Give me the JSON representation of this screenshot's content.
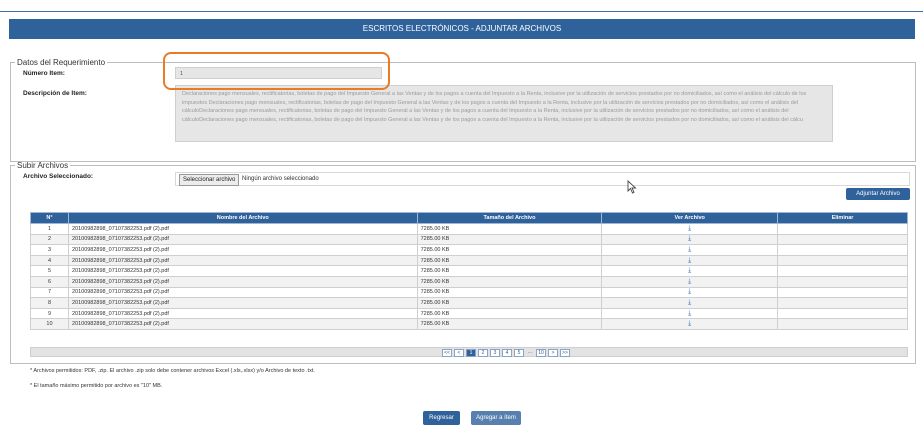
{
  "header": {
    "title": "ESCRITOS ELECTRÓNICOS - ADJUNTAR ARCHIVOS"
  },
  "requerimiento": {
    "legend": "Datos del Requerimiento",
    "numero_label": "Número Item:",
    "numero_value": "1",
    "descripcion_label": "Descripción de Item:",
    "descripcion_value": "Declaraciones pago mensuales, rectificatorias, boletas de pago del Impuesto General a las Ventas y de los pagos a cuenta del Impuesto a la Renta, inclusive por la utilización de servicios prestados por no domiciliados, así como el análisis del cálculo de los impuestos Declaraciones pago mensuales, rectificatorias, boletas de pago del Impuesto General a las Ventas y de los pagos a cuenta del Impuesto a la Renta, inclusive por la utilización de servicios prestados por no domiciliados, así como el análisis del cálculoDeclaraciones pago mensuales, rectificatorias, boletas de pago del Impuesto General a las Ventas y de los pagos a cuenta del Impuesto a la Renta, inclusive por la utilización de servicios prestados por no domiciliados, así como el análisis del cálculoDeclaraciones pago mensuales, rectificatorias, boletas de pago del Impuesto General a las Ventas y de los pagos a cuenta del Impuesto a la Renta, inclusive por la utilización de servicios prestados por no domiciliados, así como el análisis del cálcu"
  },
  "upload": {
    "legend": "Subir Archivos",
    "selected_label": "Archivo Seleccionado:",
    "select_button": "Seleccionar archivo",
    "no_file_text": "Ningún archivo seleccionado",
    "attach_button": "Adjuntar Archivo"
  },
  "table": {
    "headers": [
      "N°",
      "Nombre del Archivo",
      "Tamaño del Archivo",
      "Ver Archivo",
      "Eliminar"
    ],
    "rows": [
      {
        "n": "1",
        "name": "20100982898_07107382253.pdf (2).pdf",
        "size": "7285.00 KB"
      },
      {
        "n": "2",
        "name": "20100982898_07107382253.pdf (2).pdf",
        "size": "7285.00 KB"
      },
      {
        "n": "3",
        "name": "20100982898_07107382253.pdf (2).pdf",
        "size": "7285.00 KB"
      },
      {
        "n": "4",
        "name": "20100982898_07107382253.pdf (2).pdf",
        "size": "7285.00 KB"
      },
      {
        "n": "5",
        "name": "20100982898_07107382253.pdf (2).pdf",
        "size": "7285.00 KB"
      },
      {
        "n": "6",
        "name": "20100982898_07107382253.pdf (2).pdf",
        "size": "7285.00 KB"
      },
      {
        "n": "7",
        "name": "20100982898_07107382253.pdf (2).pdf",
        "size": "7285.00 KB"
      },
      {
        "n": "8",
        "name": "20100982898_07107382253.pdf (2).pdf",
        "size": "7285.00 KB"
      },
      {
        "n": "9",
        "name": "20100982898_07107382253.pdf (2).pdf",
        "size": "7285.00 KB"
      },
      {
        "n": "10",
        "name": "20100982898_07107382253.pdf (2).pdf",
        "size": "7285.00 KB"
      }
    ],
    "download_icon": "download-icon"
  },
  "pager": {
    "first": "<<",
    "prev": "<",
    "pages": [
      "1",
      "2",
      "3",
      "4",
      "5"
    ],
    "ellipsis": "...",
    "last_page": "10",
    "next": ">",
    "last": ">>",
    "current": "1"
  },
  "notes": {
    "formats": "* Archivos permitidos: PDF, .zip. El archivo .zip solo debe contener archivos Excel (.xls,.xlsx) y/o Archivo de texto .txt.",
    "max_size": "* El tamaño máximo permitido por archivo es \"10\" MB."
  },
  "footer": {
    "back_button": "Regresar",
    "add_button": "Agregar a ítem"
  },
  "colors": {
    "primary": "#2f619b",
    "highlight": "#e87a2a"
  }
}
